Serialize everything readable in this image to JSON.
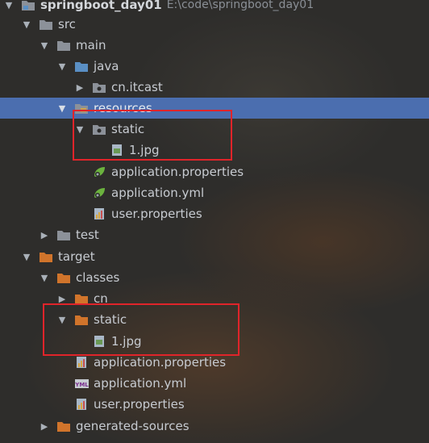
{
  "tree": {
    "root": {
      "label": "springboot_day01",
      "path": "E:\\code\\springboot_day01"
    },
    "items": [
      {
        "label": "src",
        "icon": "folder-gray-icon"
      },
      {
        "label": "main",
        "icon": "folder-gray-icon"
      },
      {
        "label": "java",
        "icon": "folder-blue-icon"
      },
      {
        "label": "cn.itcast",
        "icon": "package-icon"
      },
      {
        "label": "resources",
        "icon": "resources-folder-icon",
        "selected": true
      },
      {
        "label": "static",
        "icon": "package-icon"
      },
      {
        "label": "1.jpg",
        "icon": "image-file-icon"
      },
      {
        "label": "application.properties",
        "icon": "spring-leaf-icon"
      },
      {
        "label": "application.yml",
        "icon": "spring-leaf-icon"
      },
      {
        "label": "user.properties",
        "icon": "properties-file-icon"
      },
      {
        "label": "test",
        "icon": "folder-gray-icon"
      },
      {
        "label": "target",
        "icon": "folder-orange-icon"
      },
      {
        "label": "classes",
        "icon": "folder-orange-icon"
      },
      {
        "label": "cn",
        "icon": "folder-orange-icon"
      },
      {
        "label": "static",
        "icon": "folder-orange-icon"
      },
      {
        "label": "1.jpg",
        "icon": "image-file-icon"
      },
      {
        "label": "application.properties",
        "icon": "properties-file-icon"
      },
      {
        "label": "application.yml",
        "icon": "yml-file-icon",
        "badge": "YML"
      },
      {
        "label": "user.properties",
        "icon": "properties-file-icon"
      },
      {
        "label": "generated-sources",
        "icon": "folder-orange-icon"
      }
    ]
  },
  "colors": {
    "selection": "#4b6eaf",
    "highlight_box": "#e0242a",
    "folder_gray": "#8c9199",
    "folder_blue": "#5a8fc4",
    "folder_orange": "#d0742b"
  }
}
